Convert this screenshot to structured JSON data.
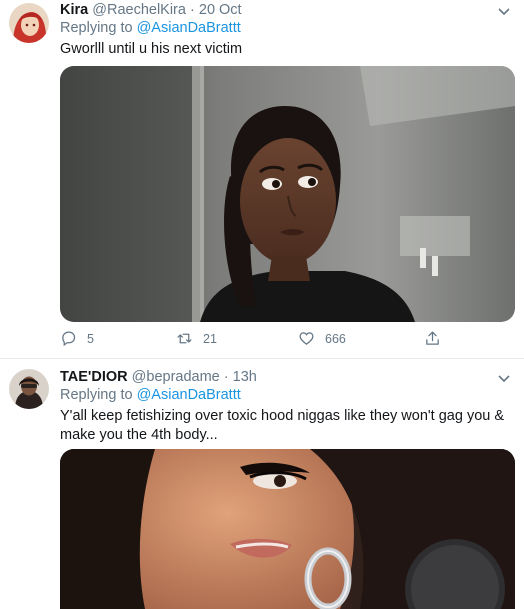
{
  "tweets": [
    {
      "display_name": "Kira",
      "handle": "@RaechelKira",
      "separator": "·",
      "time": "20 Oct",
      "replying_prefix": "Replying to ",
      "replying_to": "@AsianDaBrattt",
      "text": "Gworlll until u his next victim",
      "media_icon": "photo-woman-side-eye",
      "actions": {
        "replies": "5",
        "retweets": "21",
        "likes": "666"
      }
    },
    {
      "display_name": "TAE'DIOR",
      "handle": "@bepradame",
      "separator": "·",
      "time": "13h",
      "replying_prefix": "Replying to ",
      "replying_to": "@AsianDaBrattt",
      "text": "Y'all keep fetishizing over toxic hood niggas like they won't gag you & make you the 4th body...",
      "media_icon": "photo-woman-hoop-earring"
    }
  ],
  "colors": {
    "text": "#14171a",
    "secondary": "#657786",
    "link": "#1b95e0",
    "divider": "#e6ecf0"
  }
}
